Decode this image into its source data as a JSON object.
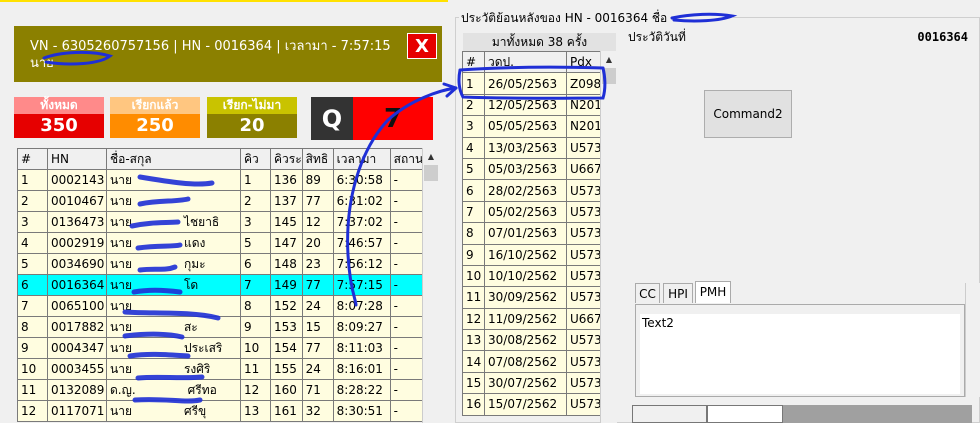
{
  "header": {
    "line1": "VN - 6305260757156 | HN - 0016364 | เวลามา - 7:57:15",
    "line2": "นาย",
    "close_label": "X"
  },
  "stats": [
    {
      "label": "ทั้งหมด",
      "value": "350"
    },
    {
      "label": "เรียกแล้ว",
      "value": "250"
    },
    {
      "label": "เรียก-ไม่มา",
      "value": "20"
    }
  ],
  "queue_display": {
    "letter": "Q",
    "number": "7"
  },
  "queue_table": {
    "columns": [
      "#",
      "HN",
      "ชื่อ-สกุล",
      "คิว",
      "คิวระ",
      "สิทธิ",
      "เวลามา",
      "สถาน"
    ],
    "rows": [
      [
        "1",
        "0002143",
        "นาย",
        "1",
        "136",
        "89",
        "6:30:58",
        "-"
      ],
      [
        "2",
        "0010467",
        "นาย",
        "2",
        "137",
        "77",
        "6:31:02",
        "-"
      ],
      [
        "3",
        "0136473",
        "นาย",
        "3",
        "145",
        "12",
        "7:37:02",
        "-"
      ],
      [
        "4",
        "0002919",
        "นาย",
        "5",
        "147",
        "20",
        "7:46:57",
        "-"
      ],
      [
        "5",
        "0034690",
        "นาย",
        "6",
        "148",
        "23",
        "7:56:12",
        "-"
      ],
      [
        "6",
        "0016364",
        "นาย",
        "7",
        "149",
        "77",
        "7:57:15",
        "-"
      ],
      [
        "7",
        "0065100",
        "นาย",
        "8",
        "152",
        "24",
        "8:07:28",
        "-"
      ],
      [
        "8",
        "0017882",
        "นาย",
        "9",
        "153",
        "15",
        "8:09:27",
        "-"
      ],
      [
        "9",
        "0004347",
        "นาย",
        "10",
        "154",
        "77",
        "8:11:03",
        "-"
      ],
      [
        "10",
        "0003455",
        "นาย",
        "11",
        "155",
        "24",
        "8:16:01",
        "-"
      ],
      [
        "11",
        "0132089",
        "ด.ญ.",
        "12",
        "160",
        "71",
        "8:28:22",
        "-"
      ],
      [
        "12",
        "0117071",
        "นาย",
        "13",
        "161",
        "32",
        "8:30:51",
        "-"
      ]
    ],
    "name_fragments": [
      "",
      "",
      "ไชยาธิ",
      "แดง",
      "กุมะ",
      "โด",
      "",
      "สะ",
      "ประเสริ",
      "รงศิริ",
      "ศรีทอ",
      "ศรีขุ"
    ],
    "selected_row": 6
  },
  "history": {
    "frame_title": "ประวัติย้อนหลังของ HN - 0016364 ชื่อ",
    "count_label": "มาทั้งหมด 38 ครั้ง",
    "columns": [
      "#",
      "วดป.",
      "Pdx"
    ],
    "rows": [
      [
        "1",
        "26/05/2563",
        "Z098"
      ],
      [
        "2",
        "12/05/2563",
        "N201"
      ],
      [
        "3",
        "05/05/2563",
        "N201"
      ],
      [
        "4",
        "13/03/2563",
        "U573"
      ],
      [
        "5",
        "05/03/2563",
        "U667"
      ],
      [
        "6",
        "28/02/2563",
        "U573"
      ],
      [
        "7",
        "05/02/2563",
        "U573"
      ],
      [
        "8",
        "07/01/2563",
        "U573"
      ],
      [
        "9",
        "16/10/2562",
        "U573"
      ],
      [
        "10",
        "10/10/2562",
        "U573"
      ],
      [
        "11",
        "30/09/2562",
        "U573"
      ],
      [
        "12",
        "11/09/2562",
        "U667"
      ],
      [
        "13",
        "30/08/2562",
        "U573"
      ],
      [
        "14",
        "07/08/2562",
        "U573"
      ],
      [
        "15",
        "30/07/2562",
        "U573"
      ],
      [
        "16",
        "15/07/2562",
        "U573"
      ]
    ]
  },
  "today": {
    "label": "ประวัติวันที่",
    "hn": "0016364",
    "command_label": "Command2",
    "tabs": [
      "CC",
      "HPI",
      "PMH"
    ],
    "active_tab": "PMH",
    "text_value": "Text2"
  },
  "colors": {
    "header_bg": "#8b8000",
    "stat_total": "#e60000",
    "stat_called": "#ff8c00",
    "stat_missed": "#8b8000",
    "selected_row": "#00ffff",
    "grid_bg": "#fffde0",
    "pen": "#1f2fd6"
  }
}
